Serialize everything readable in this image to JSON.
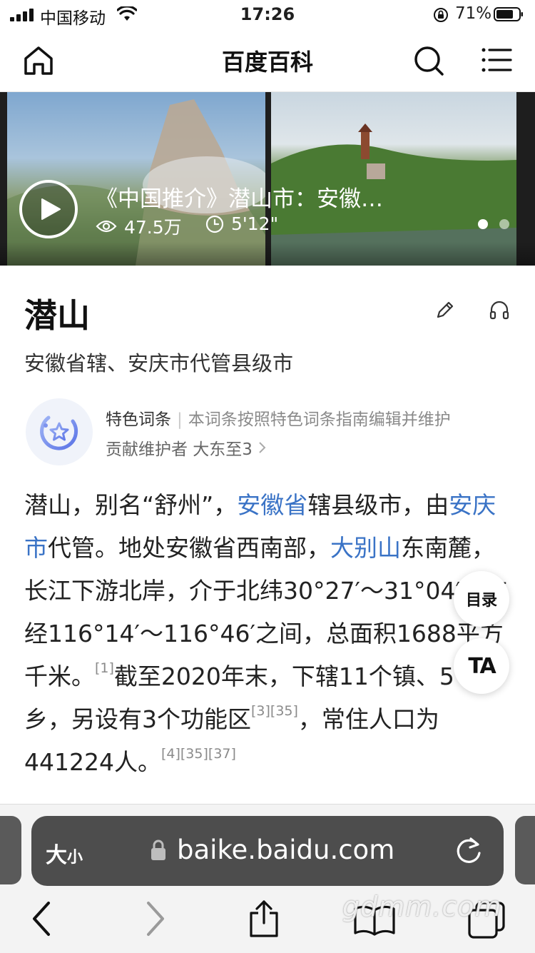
{
  "status_bar": {
    "carrier": "中国移动",
    "time": "17:26",
    "battery": "71%"
  },
  "navbar": {
    "title": "百度百科"
  },
  "video": {
    "title": "《中国推介》潜山市：安徽…",
    "views": "47.5万",
    "duration": "5'12\"",
    "slide_count": 2,
    "active_slide": 1
  },
  "entry": {
    "title": "潜山",
    "subtitle": "安徽省辖、安庆市代管县级市"
  },
  "feature": {
    "name": "特色词条",
    "separator": "|",
    "description": "本词条按照特色词条指南编辑并维护",
    "maintainer": "贡献维护者 大东至3"
  },
  "paragraph": {
    "t1": "潜山，别名“舒州”，",
    "link1": "安徽省",
    "t2": "辖县级市，由",
    "link2": "安庆市",
    "t3": "代管。地处安徽省西南部，",
    "link3": "大别山",
    "t4": "东南麓，长江下游北岸，介于北纬30°27′～31°04′与东经116°14′～116°46′之间，总面积1688平方千米。",
    "ref1": "[1]",
    "t5": "截至2020年末，下辖11个镇、5个乡，另设有3个功能区",
    "ref2": "[3][35]",
    "t6": "，常住人口为441224人。",
    "ref3": "[4][35][37]"
  },
  "floating": {
    "toc": "目录",
    "ta": "TA"
  },
  "browser": {
    "text_size_big": "大",
    "text_size_small": "小",
    "url": "baike.baidu.com"
  },
  "watermark": "gdmm.com"
}
